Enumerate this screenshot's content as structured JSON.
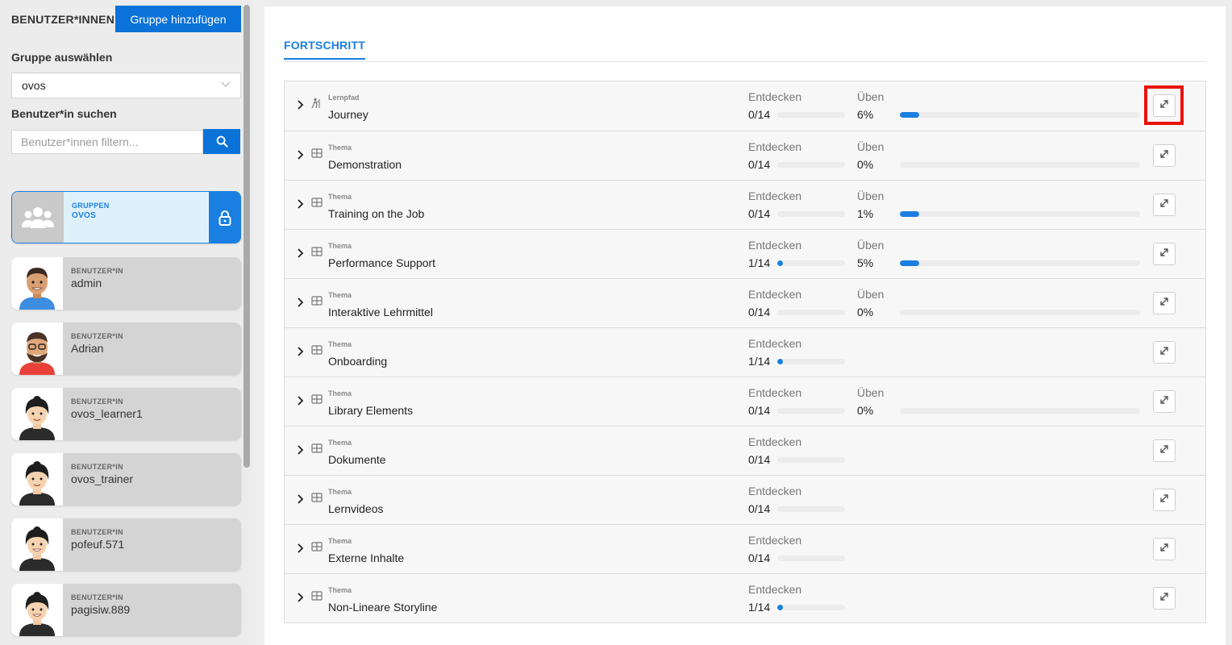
{
  "sidebar": {
    "title": "BENUTZER*INNEN",
    "add_group_label": "Gruppe hinzufügen",
    "select_group_label": "Gruppe auswählen",
    "selected_group": "ovos",
    "search_label": "Benutzer*in suchen",
    "search_placeholder": "Benutzer*innen filtern...",
    "group_card": {
      "kind": "GRUPPEN",
      "name": "OVOS"
    },
    "users": [
      {
        "kind": "BENUTZER*IN",
        "name": "admin"
      },
      {
        "kind": "BENUTZER*IN",
        "name": "Adrian"
      },
      {
        "kind": "BENUTZER*IN",
        "name": "ovos_learner1"
      },
      {
        "kind": "BENUTZER*IN",
        "name": "ovos_trainer"
      },
      {
        "kind": "BENUTZER*IN",
        "name": "pofeuf.571"
      },
      {
        "kind": "BENUTZER*IN",
        "name": "pagisiw.889"
      }
    ]
  },
  "main": {
    "tab_label": "FORTSCHRITT",
    "discover_label": "Entdecken",
    "practice_label": "Üben",
    "rows": [
      {
        "kind": "Lernpfad",
        "title": "Journey",
        "icon": "learning-path-icon",
        "discover": "0/14",
        "discover_fraction": 0.0,
        "practice": "6%",
        "practice_fraction": 0.06
      },
      {
        "kind": "Thema",
        "title": "Demonstration",
        "icon": "grid-icon",
        "discover": "0/14",
        "discover_fraction": 0.0,
        "practice": "0%",
        "practice_fraction": 0.0
      },
      {
        "kind": "Thema",
        "title": "Training on the Job",
        "icon": "grid-icon",
        "discover": "0/14",
        "discover_fraction": 0.0,
        "practice": "1%",
        "practice_fraction": 0.01
      },
      {
        "kind": "Thema",
        "title": "Performance Support",
        "icon": "grid-icon",
        "discover": "1/14",
        "discover_fraction": 0.0714,
        "practice": "5%",
        "practice_fraction": 0.05
      },
      {
        "kind": "Thema",
        "title": "Interaktive Lehrmittel",
        "icon": "grid-icon",
        "discover": "0/14",
        "discover_fraction": 0.0,
        "practice": "0%",
        "practice_fraction": 0.0
      },
      {
        "kind": "Thema",
        "title": "Onboarding",
        "icon": "grid-icon",
        "discover": "1/14",
        "discover_fraction": 0.0714
      },
      {
        "kind": "Thema",
        "title": "Library Elements",
        "icon": "grid-icon",
        "discover": "0/14",
        "discover_fraction": 0.0,
        "practice": "0%",
        "practice_fraction": 0.0
      },
      {
        "kind": "Thema",
        "title": "Dokumente",
        "icon": "grid-icon",
        "discover": "0/14",
        "discover_fraction": 0.0
      },
      {
        "kind": "Thema",
        "title": "Lernvideos",
        "icon": "grid-icon",
        "discover": "0/14",
        "discover_fraction": 0.0
      },
      {
        "kind": "Thema",
        "title": "Externe Inhalte",
        "icon": "grid-icon",
        "discover": "0/14",
        "discover_fraction": 0.0
      },
      {
        "kind": "Thema",
        "title": "Non-Lineare Storyline",
        "icon": "grid-icon",
        "discover": "1/14",
        "discover_fraction": 0.0714
      }
    ]
  },
  "colors": {
    "accent": "#1a7fe0",
    "button": "#0a72d8",
    "highlight": "#e8130c"
  }
}
